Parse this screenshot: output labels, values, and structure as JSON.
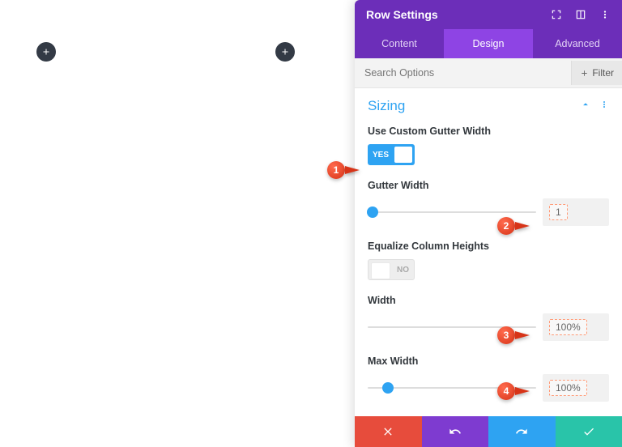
{
  "canvas": {
    "add_buttons": 2
  },
  "panel": {
    "title": "Row Settings",
    "tabs": [
      {
        "label": "Content",
        "active": false
      },
      {
        "label": "Design",
        "active": true
      },
      {
        "label": "Advanced",
        "active": false
      }
    ],
    "search_placeholder": "Search Options",
    "filter_label": "Filter"
  },
  "section": {
    "title": "Sizing"
  },
  "controls": {
    "custom_gutter": {
      "label": "Use Custom Gutter Width",
      "state": "YES"
    },
    "gutter_width": {
      "label": "Gutter Width",
      "value": "1",
      "thumb_pct": 3
    },
    "equalize": {
      "label": "Equalize Column Heights",
      "state": "NO"
    },
    "width": {
      "label": "Width",
      "value": "100%",
      "thumb_pct": 100
    },
    "max_width": {
      "label": "Max Width",
      "value": "100%",
      "thumb_pct": 12
    }
  },
  "markers": {
    "m1": "1",
    "m2": "2",
    "m3": "3",
    "m4": "4"
  }
}
